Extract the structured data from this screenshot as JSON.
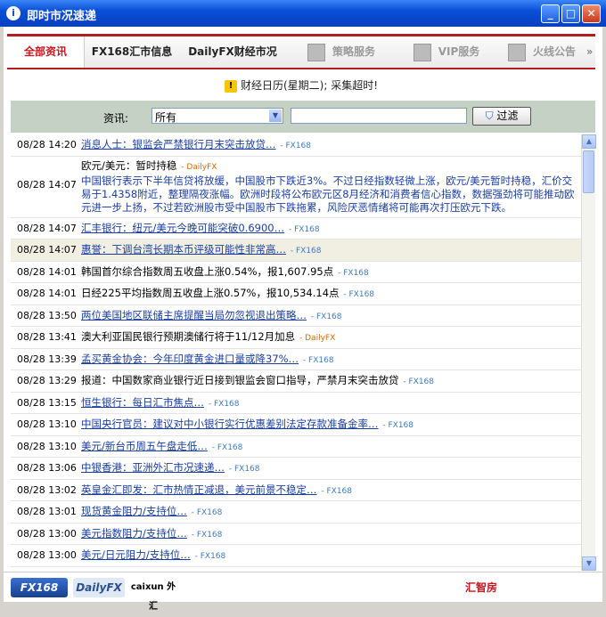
{
  "window": {
    "title": "即时市况速递"
  },
  "tabs": [
    {
      "label": "全部资讯",
      "active": true
    },
    {
      "label": "FX168汇市信息"
    },
    {
      "label": "DailyFX财经市况"
    },
    {
      "label": "策略服务",
      "icon": "chart-icon"
    },
    {
      "label": "VIP服务",
      "icon": "vip-icon"
    },
    {
      "label": "火线公告",
      "icon": "notice-icon"
    }
  ],
  "tab_more": "»",
  "notice": "财经日历(星期二); 采集超时!",
  "filter": {
    "label": "资讯:",
    "select_value": "所有",
    "input_value": "",
    "button_label": "过滤"
  },
  "news": [
    {
      "time": "08/28 14:20",
      "text": "消息人士：银监会严禁银行月末突击放贷…",
      "source": "FX168",
      "link": true
    },
    {
      "time": "08/28 14:07",
      "text": "欧元/美元：暂时持稳",
      "source": "DailyFX",
      "link": false,
      "body": "中国银行表示下半年信贷将放缓，中国股市下跌近3%。不过日经指数轻微上涨，欧元/美元暂时持稳，汇价交易于1.4358附近，整理隔夜涨幅。欧洲时段将公布欧元区8月经济和消费者信心指数，数据强劲将可能推动欧元进一步上扬，不过若欧洲股市受中国股市下跌拖累，风险厌恶情绪将可能再次打压欧元下跌。"
    },
    {
      "time": "08/28 14:07",
      "text": "汇丰银行：纽元/美元今晚可能突破0.6900…",
      "source": "FX168",
      "link": true
    },
    {
      "time": "08/28 14:07",
      "text": "惠誉：下调台湾长期本币评级可能性非常高…",
      "source": "FX168",
      "link": true,
      "highlight": true
    },
    {
      "time": "08/28 14:01",
      "text": "韩国首尔综合指数周五收盘上涨0.54%，报1,607.95点",
      "source": "FX168",
      "link": false
    },
    {
      "time": "08/28 14:01",
      "text": "日经225平均指数周五收盘上涨0.57%，报10,534.14点",
      "source": "FX168",
      "link": false
    },
    {
      "time": "08/28 13:50",
      "text": "两位美国地区联储主席提醒当局勿忽视退出策略…",
      "source": "FX168",
      "link": true
    },
    {
      "time": "08/28 13:41",
      "text": "澳大利亚国民银行预期澳储行将于11/12月加息",
      "source": "DailyFX",
      "link": false
    },
    {
      "time": "08/28 13:39",
      "text": "孟买黄金协会：今年印度黄金进口量或降37%…",
      "source": "FX168",
      "link": true
    },
    {
      "time": "08/28 13:29",
      "text": "报道：中国数家商业银行近日接到银监会窗口指导，严禁月末突击放贷",
      "source": "FX168",
      "link": false
    },
    {
      "time": "08/28 13:15",
      "text": "恒生银行：每日汇市焦点…",
      "source": "FX168",
      "link": true
    },
    {
      "time": "08/28 13:10",
      "text": "中国央行官员：建议对中小银行实行优惠差别法定存款准备金率…",
      "source": "FX168",
      "link": true
    },
    {
      "time": "08/28 13:10",
      "text": "美元/新台币周五午盘走低…",
      "source": "FX168",
      "link": true
    },
    {
      "time": "08/28 13:06",
      "text": "中银香港：亚洲外汇市况速递…",
      "source": "FX168",
      "link": true
    },
    {
      "time": "08/28 13:02",
      "text": "英皇金汇即发：汇市热情正减退，美元前景不稳定…",
      "source": "FX168",
      "link": true
    },
    {
      "time": "08/28 13:01",
      "text": "现货黄金阻力/支持位…",
      "source": "FX168",
      "link": true
    },
    {
      "time": "08/28 13:00",
      "text": "美元指数阻力/支持位…",
      "source": "FX168",
      "link": true
    },
    {
      "time": "08/28 13:00",
      "text": "美元/日元阻力/支持位…",
      "source": "FX168",
      "link": true
    }
  ],
  "footer": {
    "logos": [
      "FX168",
      "DailyFX",
      "caixun 外汇",
      "汇智房"
    ]
  }
}
